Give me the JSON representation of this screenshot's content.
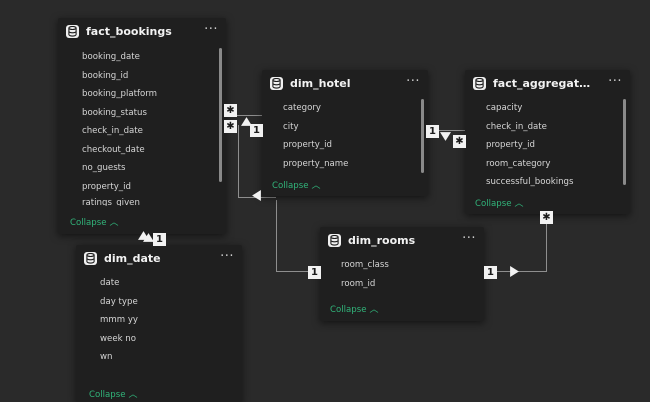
{
  "tables": {
    "fact_bookings": {
      "title": "fact_bookings",
      "fields": [
        "booking_date",
        "booking_id",
        "booking_platform",
        "booking_status",
        "check_in_date",
        "checkout_date",
        "no_guests",
        "property_id",
        "ratings_given"
      ],
      "collapse_label": "Collapse"
    },
    "dim_hotel": {
      "title": "dim_hotel",
      "fields": [
        "category",
        "city",
        "property_id",
        "property_name"
      ],
      "collapse_label": "Collapse"
    },
    "fact_aggregated_bookings": {
      "title": "fact_aggregated_booki...",
      "fields": [
        "capacity",
        "check_in_date",
        "property_id",
        "room_category",
        "successful_bookings"
      ],
      "collapse_label": "Collapse"
    },
    "dim_rooms": {
      "title": "dim_rooms",
      "fields": [
        "room_class",
        "room_id"
      ],
      "collapse_label": "Collapse"
    },
    "dim_date": {
      "title": "dim_date",
      "fields": [
        "date",
        "day type",
        "mmm yy",
        "week no",
        "wn"
      ],
      "collapse_label": "Collapse"
    }
  },
  "cardinality": {
    "many": "✱",
    "one": "1"
  },
  "icons": {
    "table": "database-icon",
    "menu": "more-icon",
    "collapse": "chevron-up-icon"
  },
  "colors": {
    "background": "#2a2a2a",
    "card": "#1f1f1f",
    "collapse_link": "#31b47a",
    "relationship_line": "#8e8e8e"
  }
}
